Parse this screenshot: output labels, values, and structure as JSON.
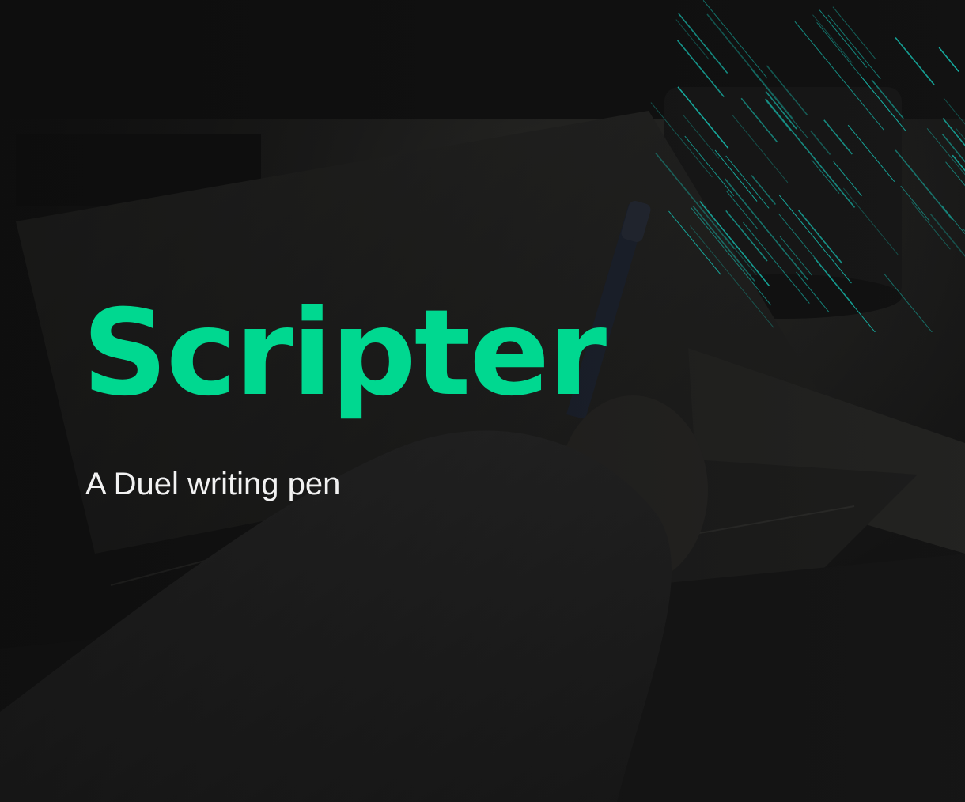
{
  "hero": {
    "title": "Scripter",
    "subtitle": "A Duel writing pen",
    "background_image": "dark-desk-hand-writing-with-pen",
    "decoration": "diagonal-rain-lines"
  },
  "colors": {
    "accent": "#00d890",
    "line_accent": "#16b3a6",
    "subtitle": "#f2f2f2",
    "background": "#141414"
  }
}
